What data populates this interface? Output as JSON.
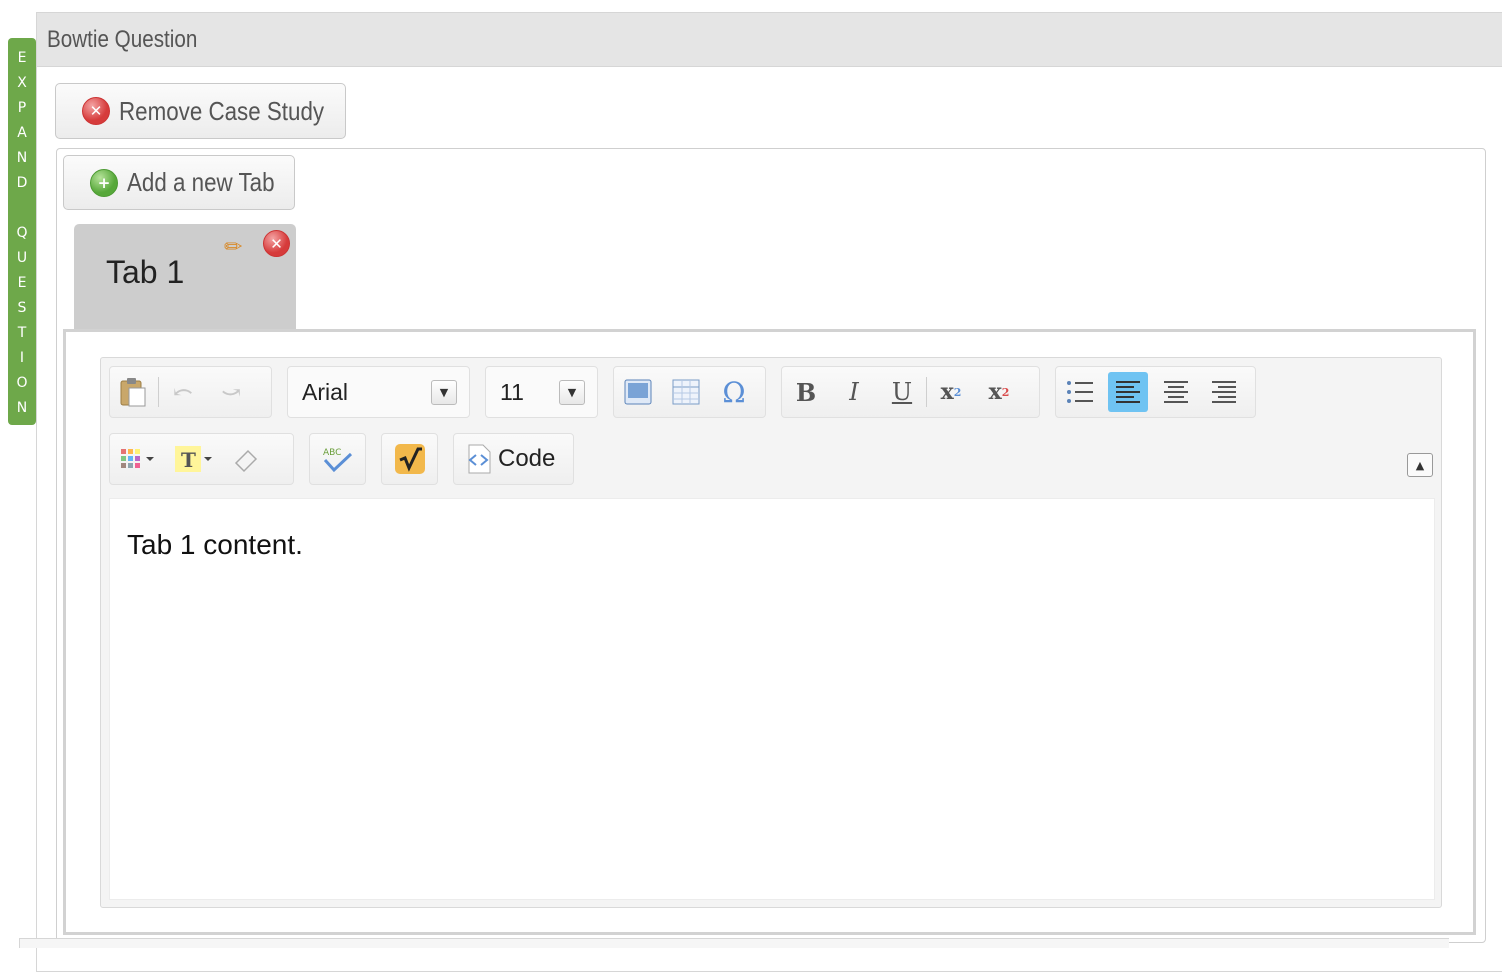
{
  "expand_bar": {
    "letters": [
      "E",
      "X",
      "P",
      "A",
      "N",
      "D",
      " ",
      "Q",
      "U",
      "E",
      "S",
      "T",
      "I",
      "O",
      "N"
    ]
  },
  "panel": {
    "title": "Bowtie Question"
  },
  "buttons": {
    "remove_case_study": "Remove Case Study",
    "add_tab": "Add a new Tab"
  },
  "tabs": [
    {
      "label": "Tab 1",
      "active": true
    }
  ],
  "toolbar": {
    "font_name": "Arial",
    "font_size": "11",
    "code_label": "Code",
    "alignment_active": "align-left"
  },
  "editor": {
    "content": "Tab 1 content."
  },
  "colors": {
    "expand_bar": "#6ea84a",
    "active_button": "#6fc3f2",
    "header_bg": "#e5e5e5"
  }
}
